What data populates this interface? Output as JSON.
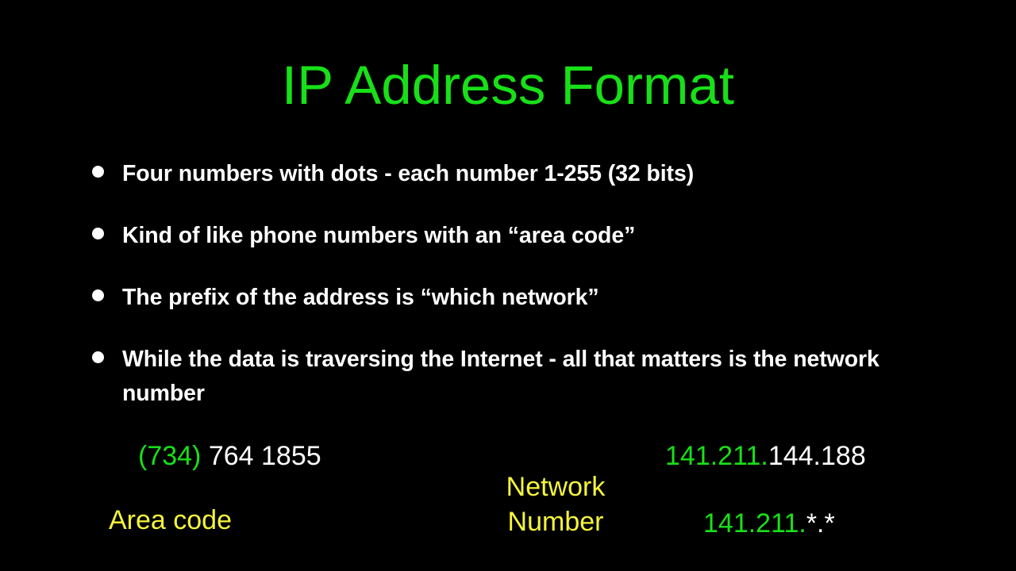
{
  "slide": {
    "background_color": "#000000",
    "title": "IP Address Format",
    "title_color": "#18E018"
  },
  "bullets": [
    {
      "text": "Four numbers with dots - each number 1-255 (32 bits)"
    },
    {
      "text": "Kind of like phone numbers with an “area code”"
    },
    {
      "text": "The prefix of the address is “which network”"
    },
    {
      "text": "While the data is traversing the Internet - all that matters is the network number"
    }
  ],
  "bullet_color": "#FFFFFF",
  "diagram": {
    "phone": {
      "area_code_part": "(734)",
      "area_code_part_color": "#18E018",
      "local_part": " 764 1855",
      "local_part_color": "#FFFFFF",
      "label": "Area code",
      "label_color": "#F5F53C"
    },
    "center_label": {
      "line1": "Network",
      "line2": "Number",
      "color": "#F5F53C"
    },
    "ip_example": {
      "network_part": "141.211.",
      "network_part_color": "#18E018",
      "host_part": "144.188",
      "host_part_color": "#FFFFFF"
    },
    "ip_wildcard": {
      "network_part": "141.211.",
      "network_part_color": "#18E018",
      "host_part": "*.*",
      "host_part_color": "#FFFFFF"
    }
  }
}
